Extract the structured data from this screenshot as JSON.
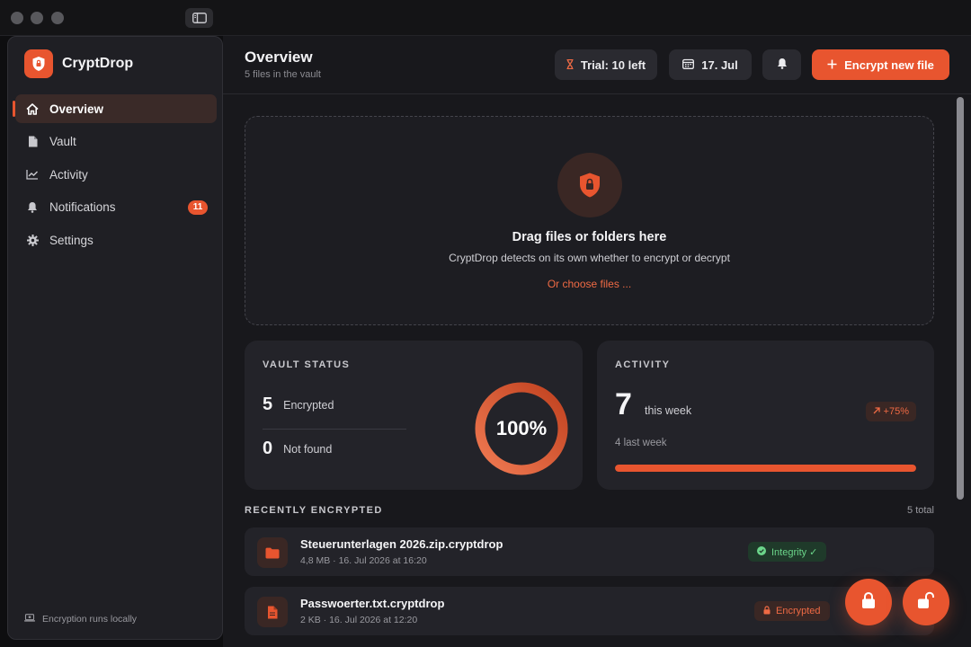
{
  "app": {
    "name": "CryptDrop",
    "accent": "#e8552f"
  },
  "sidebar": {
    "items": [
      {
        "label": "Overview",
        "icon": "home-icon",
        "active": true
      },
      {
        "label": "Vault",
        "icon": "file-icon"
      },
      {
        "label": "Activity",
        "icon": "chart-icon"
      },
      {
        "label": "Notifications",
        "icon": "bell-icon",
        "badge": "11"
      },
      {
        "label": "Settings",
        "icon": "gear-icon"
      }
    ],
    "footer": "Encryption runs locally"
  },
  "header": {
    "title": "Overview",
    "subtitle": "5 files in the vault",
    "trial_label": "Trial: 10 left",
    "date_label": "17. Jul",
    "primary_label": "Encrypt new file"
  },
  "dropzone": {
    "title": "Drag files or folders here",
    "subtitle": "CryptDrop detects on its own whether to encrypt or decrypt",
    "link": "Or choose files ..."
  },
  "vault_status": {
    "label": "VAULT STATUS",
    "encrypted_count": "5",
    "encrypted_label": "Encrypted",
    "notfound_count": "0",
    "notfound_label": "Not found",
    "percent_label": "100%",
    "percent": 100
  },
  "activity": {
    "label": "ACTIVITY",
    "count": "7",
    "count_label": "this week",
    "change": "+75%",
    "last_week": "4 last week",
    "progress_percent": 100
  },
  "recent": {
    "label": "RECENTLY ENCRYPTED",
    "count": "5 total",
    "files": [
      {
        "name": "Steuerunterlagen 2026.zip.cryptdrop",
        "meta": "4,8 MB · 16. Jul 2026 at 16:20",
        "badge": "Integrity ✓",
        "badge_type": "ok",
        "icon": "folder-icon"
      },
      {
        "name": "Passwoerter.txt.cryptdrop",
        "meta": "2 KB · 16. Jul 2026 at 12:20",
        "badge": "Encrypted",
        "badge_type": "enc",
        "icon": "document-icon"
      }
    ]
  }
}
